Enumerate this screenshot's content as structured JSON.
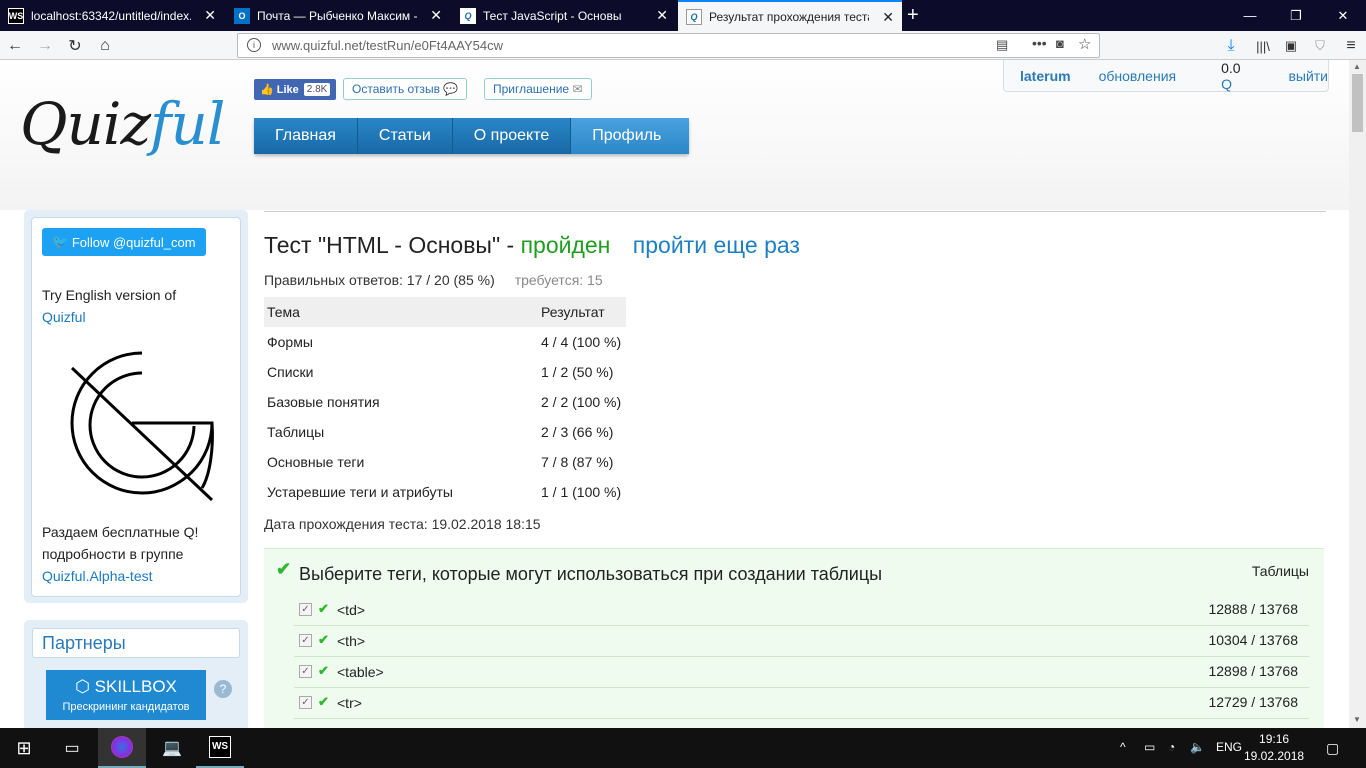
{
  "browser": {
    "tabs": [
      {
        "label": "localhost:63342/untitled/index.",
        "icon": "webstorm-icon"
      },
      {
        "label": "Почта — Рыбченко Максим -",
        "icon": "outlook-icon"
      },
      {
        "label": "Тест JavaScript - Основы",
        "icon": "quizful-icon"
      },
      {
        "label": "Результат прохождения теста",
        "icon": "quizful-icon"
      }
    ],
    "url_prefix": "www.quizful.net",
    "url_path": "/testRun/e0Ft4AAY54cw"
  },
  "header": {
    "logo_main": "Quiz",
    "logo_accent": "ful",
    "like_label": "Like",
    "like_count": "2.8K",
    "feedback_label": "Оставить отзыв",
    "invite_label": "Приглашение",
    "menu": [
      "Главная",
      "Статьи",
      "О проекте",
      "Профиль"
    ],
    "user": {
      "name": "laterum",
      "updates": "обновления",
      "balance": "0.0",
      "currency": "Q",
      "logout": "выйти"
    }
  },
  "sidebar": {
    "twitter_label": "Follow @quizful_com",
    "english_text": "Try English version of",
    "english_link": "Quizful",
    "promo_line1": "Раздаем бесплатные Q!",
    "promo_line2": "подробности в группе",
    "promo_link": "Quizful.Alpha-test",
    "partners_title": "Партнеры",
    "skillbox_name": "SKILLBOX",
    "skillbox_sub": "Прескрининг кандидатов"
  },
  "result": {
    "title_prefix": "Тест \"HTML - Основы\" -",
    "status": "пройден",
    "again_link": "пройти еще раз",
    "correct_label": "Правильных ответов: 17 / 20 (85 %)",
    "required_label": "требуется: 15",
    "table_headers": [
      "Тема",
      "Результат"
    ],
    "table_rows": [
      [
        "Формы",
        "4 / 4 (100 %)"
      ],
      [
        "Списки",
        "1 / 2 (50 %)"
      ],
      [
        "Базовые понятия",
        "2 / 2 (100 %)"
      ],
      [
        "Таблицы",
        "2 / 3 (66 %)"
      ],
      [
        "Основные теги",
        "7 / 8 (87 %)"
      ],
      [
        "Устаревшие теги и атрибуты",
        "1 / 1 (100 %)"
      ]
    ],
    "date_label": "Дата прохождения теста: 19.02.2018 18:15"
  },
  "question": {
    "title": "Выберите теги, которые могут использоваться при создании таблицы",
    "topic": "Таблицы",
    "answers": [
      {
        "text": "<td>",
        "count": "12888 / 13768"
      },
      {
        "text": "<th>",
        "count": "10304 / 13768"
      },
      {
        "text": "<table>",
        "count": "12898 / 13768"
      },
      {
        "text": "<tr>",
        "count": "12729 / 13768"
      }
    ]
  },
  "taskbar": {
    "lang": "ENG",
    "time": "19:16",
    "date": "19.02.2018"
  }
}
